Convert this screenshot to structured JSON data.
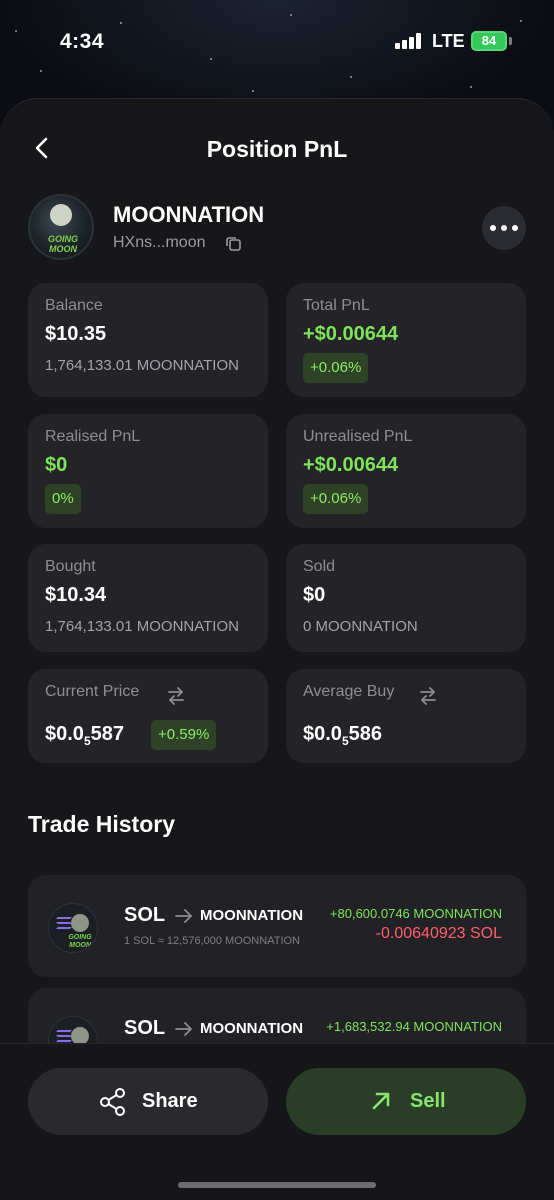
{
  "status_bar": {
    "time": "4:34",
    "network": "LTE",
    "battery": "84"
  },
  "header": {
    "title": "Position PnL"
  },
  "token": {
    "name": "MOONNATION",
    "address": "HXns...moon",
    "avatar_text": "GOING MOON"
  },
  "cards": {
    "balance": {
      "label": "Balance",
      "value": "$10.35",
      "sub": "1,764,133.01 MOONNATION"
    },
    "total_pnl": {
      "label": "Total PnL",
      "value": "+$0.00644",
      "pct": "+0.06%"
    },
    "realised_pnl": {
      "label": "Realised PnL",
      "value": "$0",
      "pct": "0%"
    },
    "unrealised_pnl": {
      "label": "Unrealised PnL",
      "value": "+$0.00644",
      "pct": "+0.06%"
    },
    "bought": {
      "label": "Bought",
      "value": "$10.34",
      "sub": "1,764,133.01 MOONNATION"
    },
    "sold": {
      "label": "Sold",
      "value": "$0",
      "sub": "0 MOONNATION"
    },
    "current_price": {
      "label": "Current Price",
      "prefix": "$0.0",
      "sub_digit": "5",
      "suffix": "587",
      "pct": "+0.59%"
    },
    "average_buy": {
      "label": "Average Buy",
      "prefix": "$0.0",
      "sub_digit": "5",
      "suffix": "586"
    }
  },
  "trade_history": {
    "title": "Trade History",
    "trades": [
      {
        "from": "SOL",
        "to": "MOONNATION",
        "rate": "1 SOL ≈  12,576,000 MOONNATION",
        "received": "+80,600.0746 MOONNATION",
        "spent": "-0.00640923 SOL"
      },
      {
        "from": "SOL",
        "to": "MOONNATION",
        "received": "+1,683,532.94 MOONNATION"
      }
    ]
  },
  "actions": {
    "share_label": "Share",
    "sell_label": "Sell"
  },
  "colors": {
    "positive": "#7ee35a",
    "negative": "#ff5e6b",
    "card_bg": "#242428",
    "sell_bg": "#2a3d27"
  }
}
